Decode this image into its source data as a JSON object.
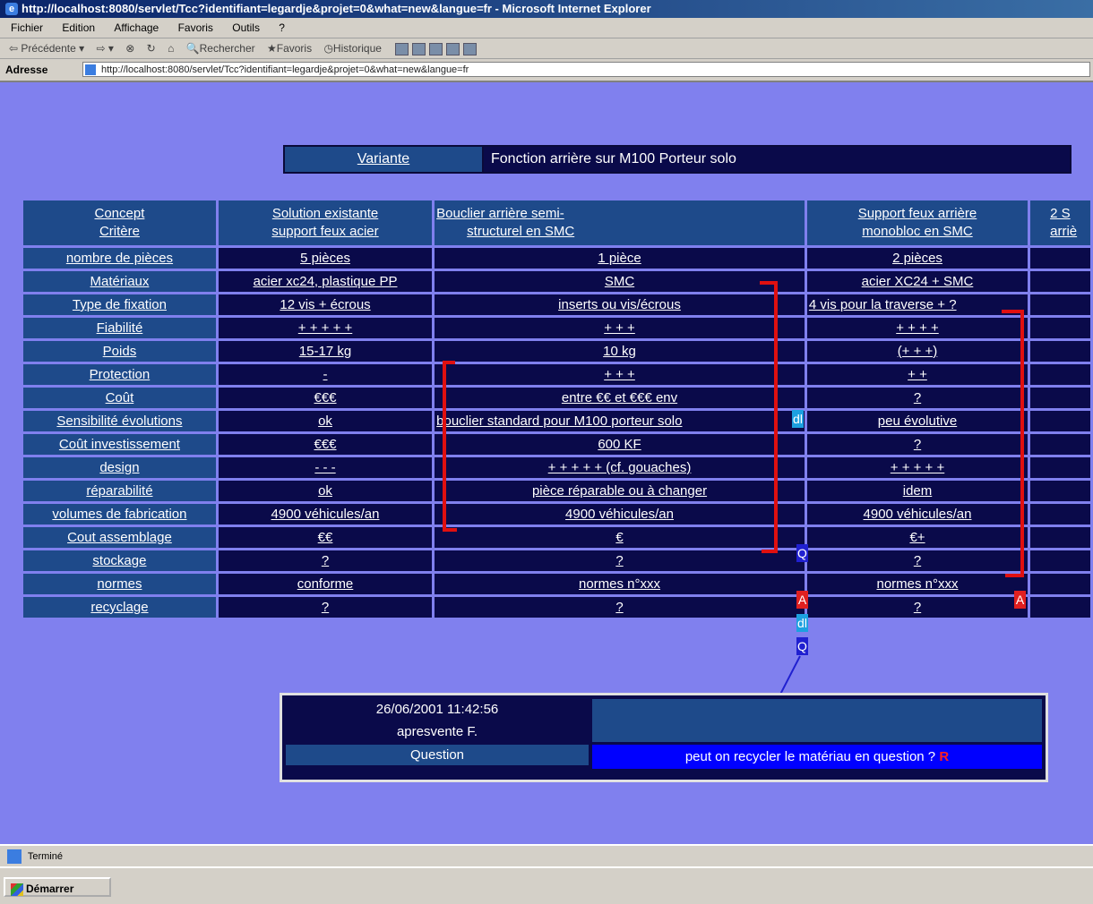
{
  "window": {
    "title": "http://localhost:8080/servlet/Tcc?identifiant=legardje&projet=0&what=new&langue=fr - Microsoft Internet Explorer"
  },
  "menu": [
    "Fichier",
    "Edition",
    "Affichage",
    "Favoris",
    "Outils",
    "?"
  ],
  "toolbar": {
    "back": "Précédente",
    "search": "Rechercher",
    "favorites": "Favoris",
    "history": "Historique"
  },
  "address": {
    "label": "Adresse",
    "url": "http://localhost:8080/servlet/Tcc?identifiant=legardje&projet=0&what=new&langue=fr"
  },
  "variante": {
    "label": "Variante",
    "value": "Fonction arrière sur M100 Porteur solo"
  },
  "table": {
    "header_first_line1": "Concept",
    "header_first_line2": "Critère",
    "columns": [
      {
        "line1": "Solution existante",
        "line2": "support feux acier"
      },
      {
        "line1": "Bouclier arrière semi-",
        "line2": "structurel en SMC"
      },
      {
        "line1": "Support feux arrière",
        "line2": "monobloc en SMC"
      },
      {
        "line1": "2 S",
        "line2": "arriè"
      }
    ],
    "rows": [
      {
        "label": "nombre de pièces",
        "cells": [
          "5 pièces",
          "1 pièce",
          "2 pièces",
          ""
        ]
      },
      {
        "label": "Matériaux",
        "cells": [
          "acier xc24, plastique PP",
          "SMC",
          "acier XC24 + SMC",
          ""
        ]
      },
      {
        "label": "Type de fixation",
        "cells": [
          "12 vis + écrous",
          "inserts ou vis/écrous",
          "4 vis pour la traverse + ?",
          ""
        ]
      },
      {
        "label": "Fiabilité",
        "cells": [
          "+ + + + +",
          "+ + +",
          "+ + + +",
          ""
        ]
      },
      {
        "label": "Poids",
        "cells": [
          "15-17 kg",
          "10 kg",
          "(+ + +)",
          ""
        ]
      },
      {
        "label": "Protection",
        "cells": [
          "-",
          "+ + +",
          "+ +",
          ""
        ]
      },
      {
        "label": "Coût",
        "cells": [
          "€€€",
          "entre €€ et €€€ env",
          "?",
          ""
        ]
      },
      {
        "label": "Sensibilité évolutions",
        "cells": [
          "ok",
          "bouclier standard pour M100 porteur solo",
          "peu évolutive",
          ""
        ]
      },
      {
        "label": "Coût investissement",
        "cells": [
          "€€€",
          "600 KF",
          "?",
          ""
        ]
      },
      {
        "label": "design",
        "cells": [
          "- - -",
          "+ + + + + (cf. gouaches)",
          "+ + + + +",
          ""
        ]
      },
      {
        "label": "réparabilité",
        "cells": [
          "ok",
          "pièce réparable ou à changer",
          "idem",
          ""
        ]
      },
      {
        "label": "volumes de fabrication",
        "cells": [
          "4900 véhicules/an",
          "4900 véhicules/an",
          "4900 véhicules/an",
          ""
        ]
      },
      {
        "label": "Cout assemblage",
        "cells": [
          "€€",
          "€",
          "€+",
          ""
        ]
      },
      {
        "label": "stockage",
        "cells": [
          "?",
          "?",
          "?",
          ""
        ]
      },
      {
        "label": "normes",
        "cells": [
          "conforme",
          "normes n°xxx",
          "normes n°xxx",
          ""
        ]
      },
      {
        "label": "recyclage",
        "cells": [
          "?",
          "?",
          "?",
          ""
        ]
      }
    ],
    "tags": {
      "dl": "dl",
      "q": "Q",
      "a": "A"
    }
  },
  "info": {
    "datetime": "26/06/2001 11:42:56",
    "author": "apresvente F.",
    "type_label": "Question",
    "question": "peut on recycler le matériau en question ?",
    "question_tag": "R"
  },
  "status": {
    "text": "Terminé"
  },
  "taskbar": {
    "start": "Démarrer"
  },
  "colors": {
    "page_bg": "#8080ee",
    "header_cell": "#1e4a8a",
    "data_cell": "#0a0a4a",
    "bracket": "#e01010"
  }
}
